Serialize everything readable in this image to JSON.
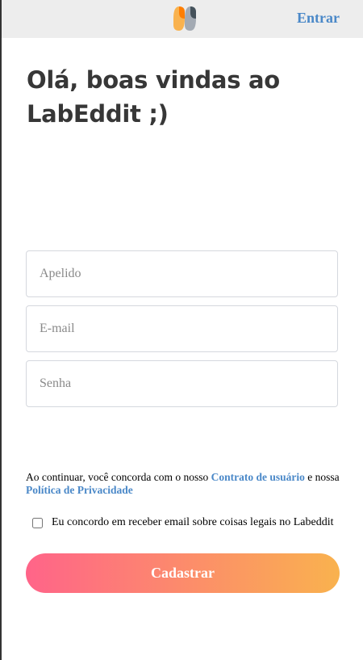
{
  "header": {
    "logo_icon": "labeddit-logo-icon",
    "login_label": "Entrar"
  },
  "main": {
    "title": "Olá, boas vindas ao LabEddit ;)"
  },
  "form": {
    "nickname_placeholder": "Apelido",
    "email_placeholder": "E-mail",
    "password_placeholder": "Senha",
    "terms_prefix": "Ao continuar, você concorda com o nosso ",
    "terms_link": "Contrato de usuário",
    "terms_middle": " e nossa ",
    "privacy_link": "Política de Privacidade",
    "newsletter_label": "Eu concordo em receber email sobre coisas legais no Labeddit",
    "submit_label": "Cadastrar"
  },
  "colors": {
    "accent": "#4a88c8",
    "gradient_start": "#ff6489",
    "gradient_end": "#f9b24e",
    "logo_orange": "#f9b24e",
    "logo_orange_dark": "#fe7e02",
    "logo_gray": "#a3aab3",
    "logo_gray_dark": "#45525b"
  }
}
